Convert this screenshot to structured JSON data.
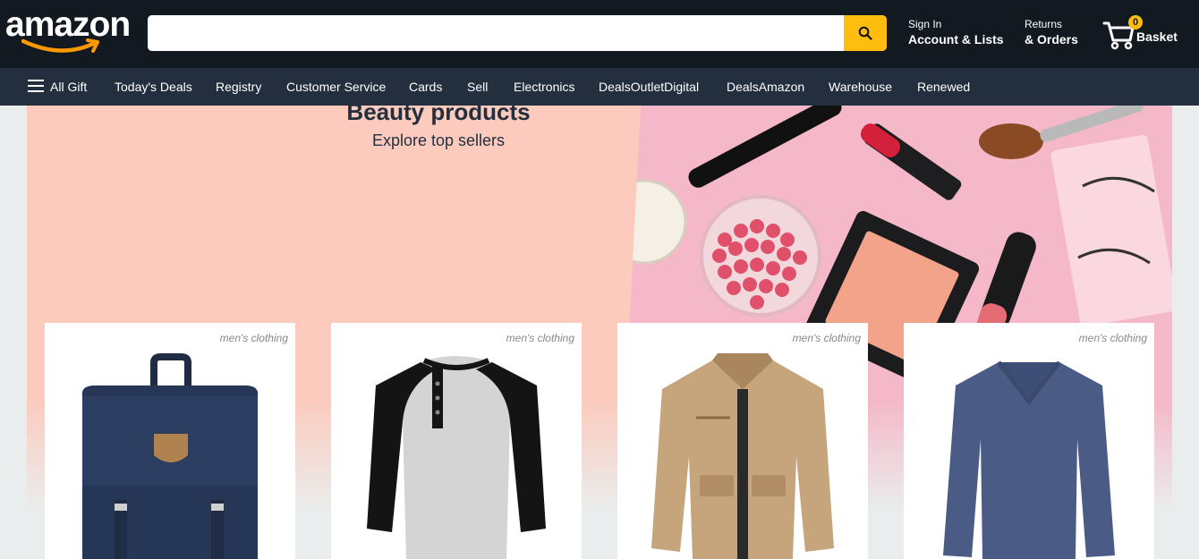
{
  "header": {
    "logo": "amazon",
    "search": {
      "placeholder": "",
      "value": ""
    },
    "signin": {
      "line1": "Sign In",
      "line2": "Account & Lists"
    },
    "returns": {
      "line1": "Returns",
      "line2": "& Orders"
    },
    "basket": {
      "count": "0",
      "label": "Basket"
    }
  },
  "subnav": {
    "items": [
      "All Gift",
      "Today's Deals",
      "Registry",
      "Customer Service",
      "Cards",
      "Sell",
      "Electronics",
      "DealsOutletDigital",
      "DealsAmazon",
      "Warehouse",
      "Renewed"
    ]
  },
  "hero": {
    "title": "Beauty products",
    "subtitle": "Explore top sellers"
  },
  "products": [
    {
      "category": "men's clothing",
      "image": "backpack-icon"
    },
    {
      "category": "men's clothing",
      "image": "raglan-shirt-icon"
    },
    {
      "category": "men's clothing",
      "image": "jacket-icon"
    },
    {
      "category": "men's clothing",
      "image": "sweater-icon"
    }
  ],
  "colors": {
    "header_bg": "#131921",
    "subnav_bg": "#232f3e",
    "accent": "#febd0f",
    "logo_smile": "#f90"
  }
}
